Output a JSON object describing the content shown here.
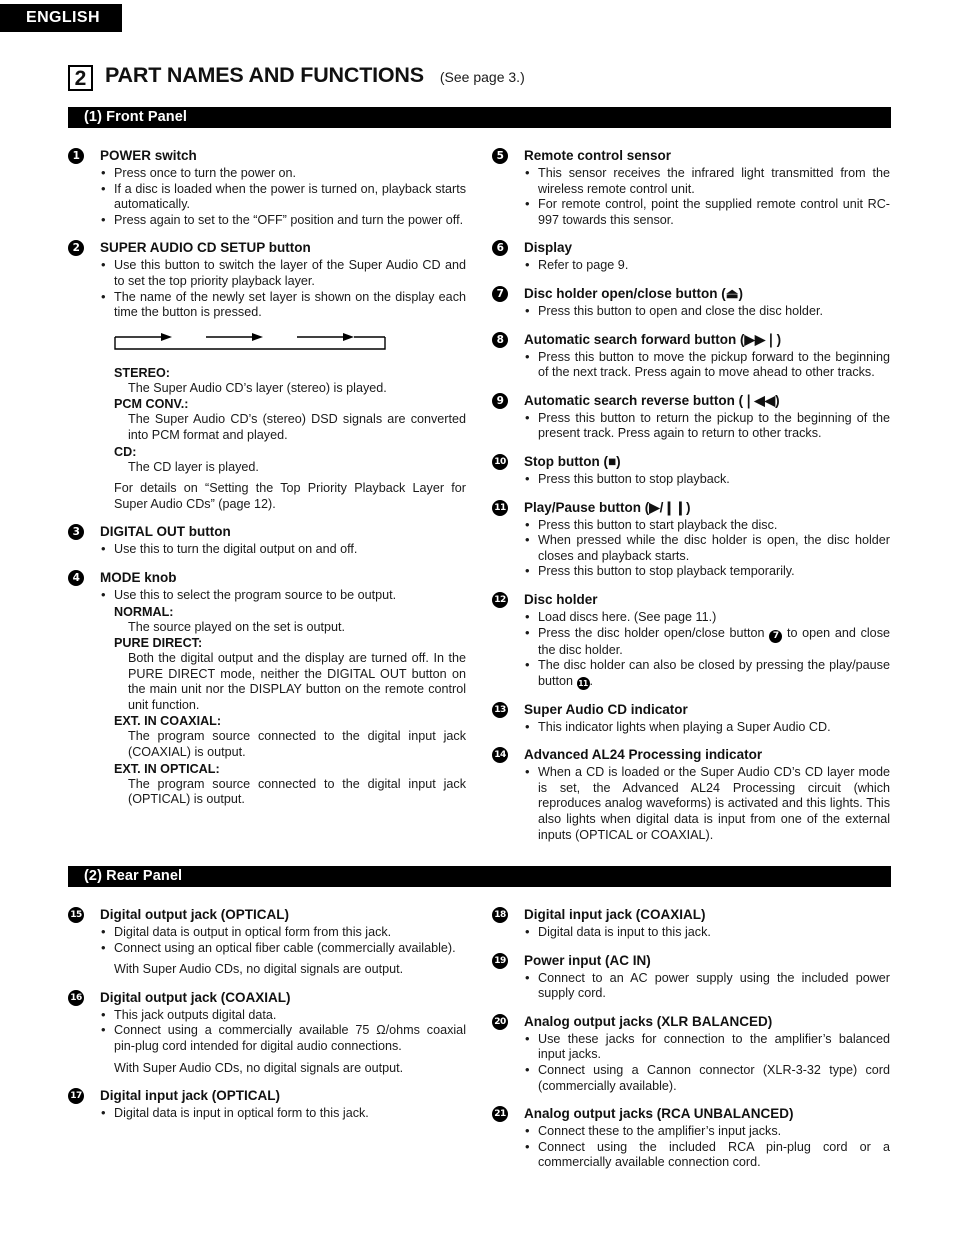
{
  "language_tab": "ENGLISH",
  "chapter": {
    "number": "2",
    "title": "PART NAMES AND FUNCTIONS",
    "reference": "(See page 3.)"
  },
  "sections": {
    "front_panel": {
      "bar_label": "(1) Front Panel"
    },
    "rear_panel": {
      "bar_label": "(2) Rear Panel"
    }
  },
  "front_panel_left": [
    {
      "num": "1",
      "title": "POWER switch",
      "bullets": [
        "Press once to turn the power on.",
        "If a disc is loaded when the power is turned on, playback starts automatically.",
        "Press again to set to the “OFF” position and turn the power off."
      ]
    },
    {
      "num": "2",
      "title": "SUPER AUDIO CD SETUP button",
      "bullets": [
        "Use this button to switch the layer of the Super Audio CD and to set the top priority playback layer.",
        "The name of the newly set layer is shown on the display each time the button is pressed."
      ],
      "diagram": {
        "type": "loop-cycle",
        "arrows": 3,
        "description": "cyclic loop arrow diagram"
      },
      "definitions": [
        {
          "term": "STEREO:",
          "def": "The Super Audio CD’s layer (stereo) is played."
        },
        {
          "term": "PCM CONV.:",
          "def": "The Super Audio CD’s (stereo) DSD signals are converted into PCM format and played."
        },
        {
          "term": "CD:",
          "def": "The CD layer is played."
        }
      ],
      "note": "For details on “Setting the Top Priority Playback Layer for Super Audio CDs” (page 12)."
    },
    {
      "num": "3",
      "title": "DIGITAL OUT button",
      "bullets": [
        "Use this to turn the digital output on and off."
      ]
    },
    {
      "num": "4",
      "title": "MODE knob",
      "bullets": [
        "Use this to select the program source to be output."
      ],
      "definitions": [
        {
          "term": "NORMAL:",
          "def": "The source played on the set is output."
        },
        {
          "term": "PURE DIRECT:",
          "def": "Both the digital output and the display are turned off. In the PURE DIRECT mode, neither the DIGITAL OUT button on the main unit nor the DISPLAY button on the remote control unit function."
        },
        {
          "term": "EXT. IN COAXIAL:",
          "def": "The program source connected to the digital input jack (COAXIAL) is output."
        },
        {
          "term": "EXT. IN OPTICAL:",
          "def": "The program source connected to the digital input jack (OPTICAL) is output."
        }
      ]
    }
  ],
  "front_panel_right": [
    {
      "num": "5",
      "title": "Remote control sensor",
      "bullets": [
        "This sensor receives the infrared light transmitted from the wireless remote control unit.",
        "For remote control, point the supplied remote control unit RC-997 towards this sensor."
      ]
    },
    {
      "num": "6",
      "title": "Display",
      "bullets": [
        "Refer to page 9."
      ]
    },
    {
      "num": "7",
      "title": "Disc holder open/close button (⏏)",
      "bullets": [
        "Press this button to open and close the disc holder."
      ]
    },
    {
      "num": "8",
      "title": "Automatic search forward button (▶▶❘)",
      "bullets": [
        "Press this button to move the pickup forward to the beginning of the next track. Press again to move ahead to other tracks."
      ]
    },
    {
      "num": "9",
      "title": "Automatic search reverse button (❘◀◀)",
      "bullets": [
        "Press this button to return the pickup to the beginning of the present track. Press again to return to other tracks."
      ]
    },
    {
      "num": "10",
      "title": "Stop button (■)",
      "bullets": [
        "Press this button to stop playback."
      ]
    },
    {
      "num": "11",
      "title": "Play/Pause button (▶/❙❙)",
      "bullets": [
        "Press this button to start playback the disc.",
        "When pressed while the disc holder is open, the disc holder closes and playback starts.",
        "Press this button to stop playback temporarily."
      ]
    },
    {
      "num": "12",
      "title": "Disc holder",
      "bullets_rich": [
        {
          "text": "Load discs here. (See page 11.)"
        },
        {
          "pre": "Press the disc holder open/close button ",
          "badge": "7",
          "post": " to open and close the disc holder."
        },
        {
          "pre": "The disc holder can also be closed by pressing the play/pause button ",
          "badge": "11",
          "post": "."
        }
      ]
    },
    {
      "num": "13",
      "title": "Super Audio CD indicator",
      "bullets": [
        "This indicator lights when playing a Super Audio CD."
      ]
    },
    {
      "num": "14",
      "title": "Advanced AL24 Processing indicator",
      "bullets": [
        "When a CD is loaded or the Super Audio CD’s CD layer mode is set, the Advanced AL24 Processing circuit (which reproduces analog waveforms) is activated and this lights. This also lights when digital data is input from one of the external inputs (OPTICAL or COAXIAL)."
      ]
    }
  ],
  "rear_panel_left": [
    {
      "num": "15",
      "title": "Digital output jack (OPTICAL)",
      "bullets": [
        "Digital data is output in optical form from this jack.",
        "Connect using an optical fiber cable (commercially available)."
      ],
      "trailing_note": "With Super Audio CDs, no digital signals are output."
    },
    {
      "num": "16",
      "title": "Digital output jack (COAXIAL)",
      "bullets": [
        "This jack outputs digital data.",
        "Connect using a commercially available 75 Ω/ohms coaxial pin-plug cord intended for digital audio connections."
      ],
      "trailing_note": "With Super Audio CDs, no digital signals are output."
    },
    {
      "num": "17",
      "title": "Digital input jack (OPTICAL)",
      "bullets": [
        "Digital data is input in optical form to this jack."
      ]
    }
  ],
  "rear_panel_right": [
    {
      "num": "18",
      "title": "Digital input jack (COAXIAL)",
      "bullets": [
        "Digital data is input to this jack."
      ]
    },
    {
      "num": "19",
      "title": "Power input (AC IN)",
      "bullets": [
        "Connect to an AC power supply using the included power supply cord."
      ]
    },
    {
      "num": "20",
      "title": "Analog output jacks (XLR BALANCED)",
      "bullets": [
        "Use these jacks for connection to the amplifier’s balanced input jacks.",
        "Connect using a Cannon connector (XLR-3-32 type) cord (commercially available)."
      ]
    },
    {
      "num": "21",
      "title": "Analog output jacks (RCA UNBALANCED)",
      "bullets": [
        "Connect these to the amplifier’s input jacks.",
        "Connect using the included RCA pin-plug cord or a commercially available connection cord."
      ]
    }
  ],
  "colors": {
    "ink": "#000000",
    "paper": "#ffffff",
    "body_text": "#1a1a1a"
  }
}
